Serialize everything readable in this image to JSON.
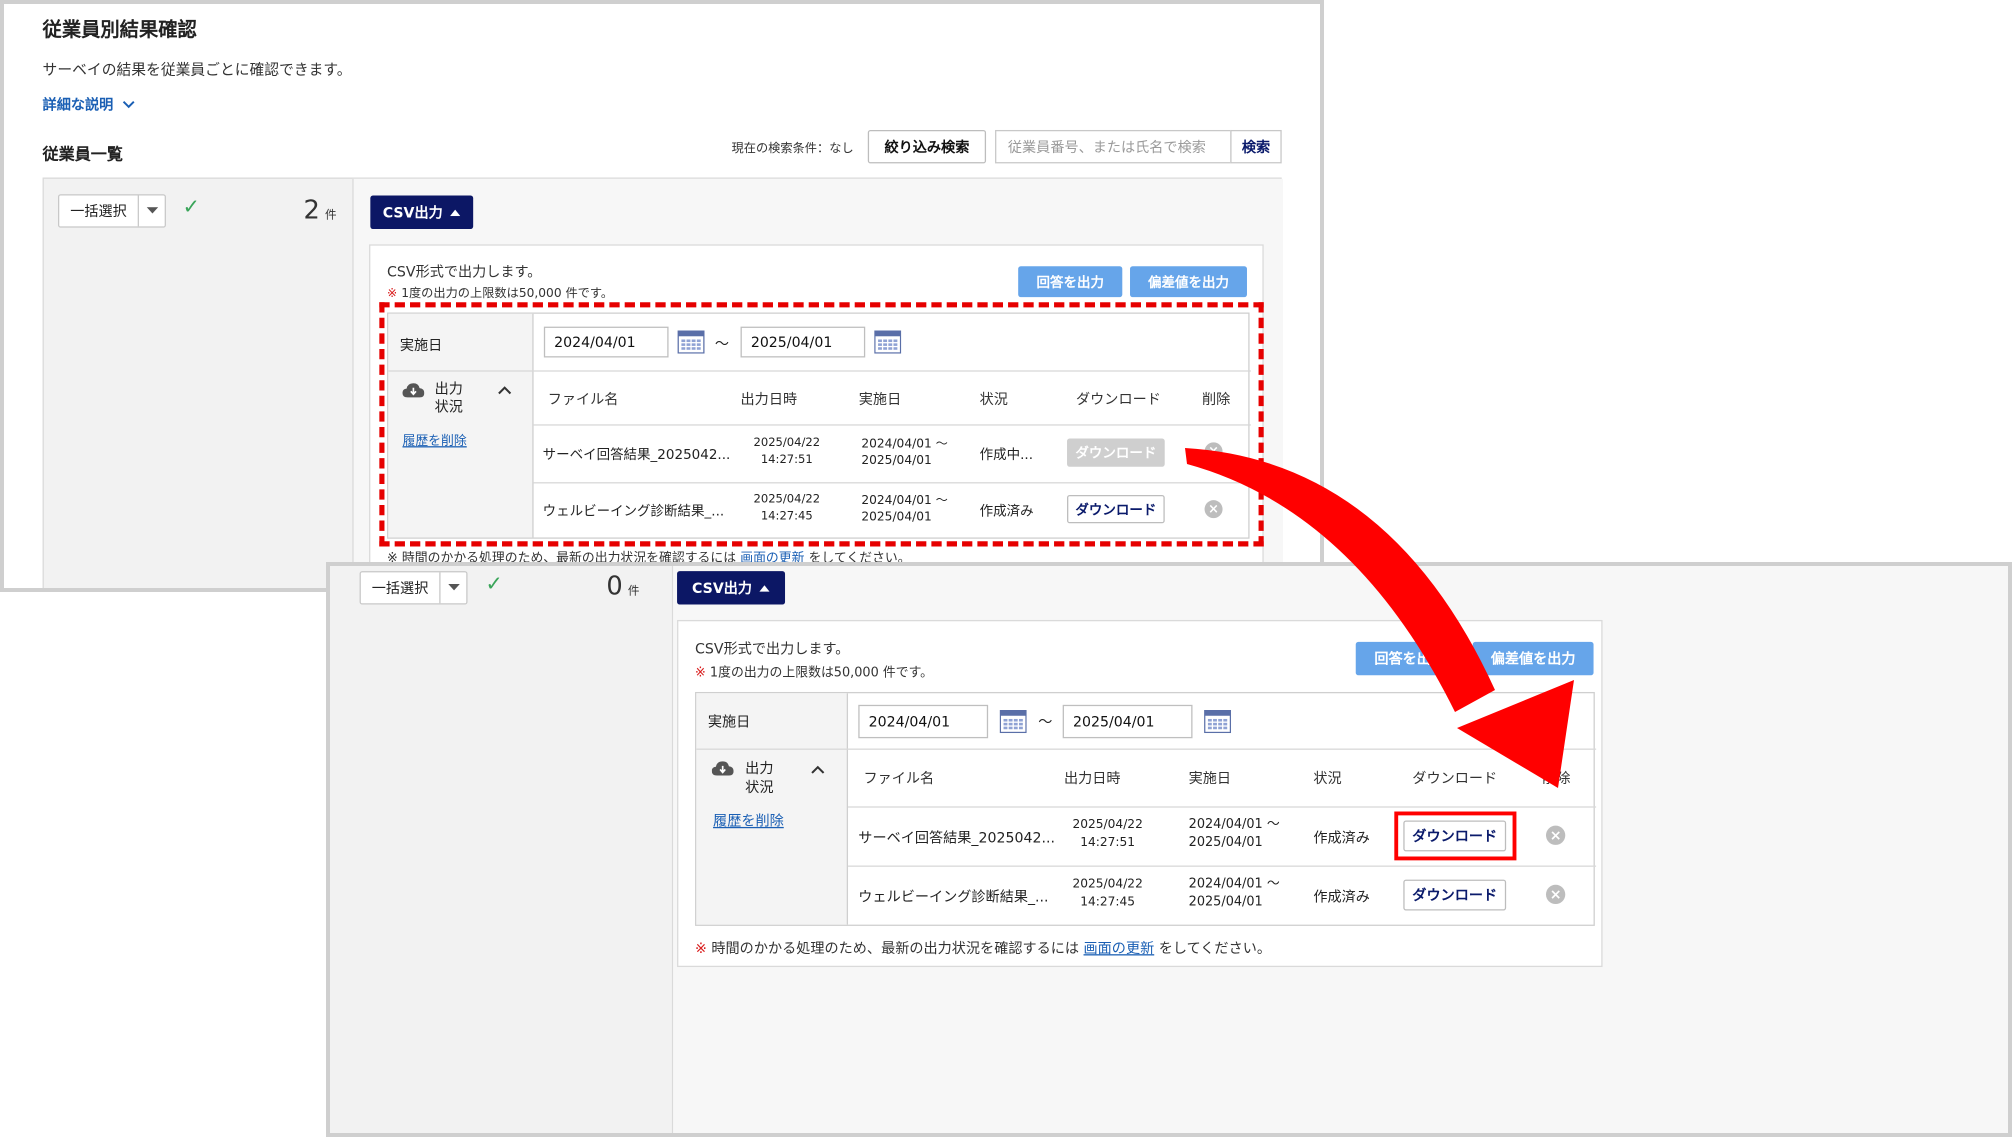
{
  "screen1": {
    "page_title": "従業員別結果確認",
    "description": "サーベイの結果を従業員ごとに確認できます。",
    "detail_link": "詳細な説明",
    "list_title": "従業員一覧",
    "filter_condition": "現在の検索条件：なし",
    "filter_button": "絞り込み検索",
    "search_placeholder": "従業員番号、または氏名で検索",
    "search_button": "検索",
    "bulk_select": "一括選択",
    "count_value": "2",
    "count_unit": "件",
    "csv_button": "CSV出力",
    "csv_desc": "CSV形式で出力します。",
    "limit_mark": "※",
    "limit_note": "1度の出力の上限数は50,000 件です。",
    "answer_button": "回答を出力",
    "deviation_button": "偏差値を出力",
    "date_label": "実施日",
    "date_from": "2024/04/01",
    "date_tilde": "～",
    "date_to": "2025/04/01",
    "output_status_label_1": "出力",
    "output_status_label_2": "状況",
    "delete_history": "履歴を削除",
    "headers": {
      "file": "ファイル名",
      "output_at": "出力日時",
      "date": "実施日",
      "status": "状況",
      "download": "ダウンロード",
      "delete": "削除"
    },
    "rows": [
      {
        "file": "サーベイ回答結果_2025042...",
        "out_date": "2025/04/22",
        "out_time": "14:27:51",
        "range_from": "2024/04/01 ～",
        "range_to": "2025/04/01",
        "status": "作成中...",
        "download": "ダウンロード"
      },
      {
        "file": "ウェルビーイング診断結果_...",
        "out_date": "2025/04/22",
        "out_time": "14:27:45",
        "range_from": "2024/04/01 ～",
        "range_to": "2025/04/01",
        "status": "作成済み",
        "download": "ダウンロード"
      }
    ],
    "footer_note_pre": "※ 時間のかかる処理のため、最新の出力状況を確認するには",
    "footer_link": "画面の更新",
    "footer_note_post": "をしてください。"
  },
  "screen2": {
    "bulk_select": "一括選択",
    "count_value": "0",
    "count_unit": "件",
    "csv_button": "CSV出力",
    "csv_desc": "CSV形式で出力します。",
    "limit_mark": "※",
    "limit_note": "1度の出力の上限数は50,000 件です。",
    "answer_button": "回答を出力",
    "deviation_button": "偏差値を出力",
    "date_label": "実施日",
    "date_from": "2024/04/01",
    "date_tilde": "～",
    "date_to": "2025/04/01",
    "output_status_label_1": "出力",
    "output_status_label_2": "状況",
    "delete_history": "履歴を削除",
    "headers": {
      "file": "ファイル名",
      "output_at": "出力日時",
      "date": "実施日",
      "status": "状況",
      "download": "ダウンロード",
      "delete": "削除"
    },
    "rows": [
      {
        "file": "サーベイ回答結果_2025042...",
        "out_date": "2025/04/22",
        "out_time": "14:27:51",
        "range_from": "2024/04/01 ～",
        "range_to": "2025/04/01",
        "status": "作成済み",
        "download": "ダウンロード"
      },
      {
        "file": "ウェルビーイング診断結果_...",
        "out_date": "2025/04/22",
        "out_time": "14:27:45",
        "range_from": "2024/04/01 ～",
        "range_to": "2025/04/01",
        "status": "作成済み",
        "download": "ダウンロード"
      }
    ],
    "footer_mark": "※",
    "footer_note_pre": "時間のかかる処理のため、最新の出力状況を確認するには",
    "footer_link": "画面の更新",
    "footer_note_post": "をしてください。"
  },
  "colors": {
    "annotation_red": "#e60000",
    "csv_navy": "#0c1765",
    "button_blue": "#66a5ea",
    "link_blue": "#1a5fb4",
    "check_green": "#3aa55a"
  },
  "icons": [
    "chevron-down-icon",
    "caret-down-icon",
    "check-icon",
    "caret-up-icon",
    "calendar-icon",
    "cloud-download-icon",
    "chevron-up-icon",
    "close-circle-icon",
    "arrow-annotation-icon"
  ]
}
